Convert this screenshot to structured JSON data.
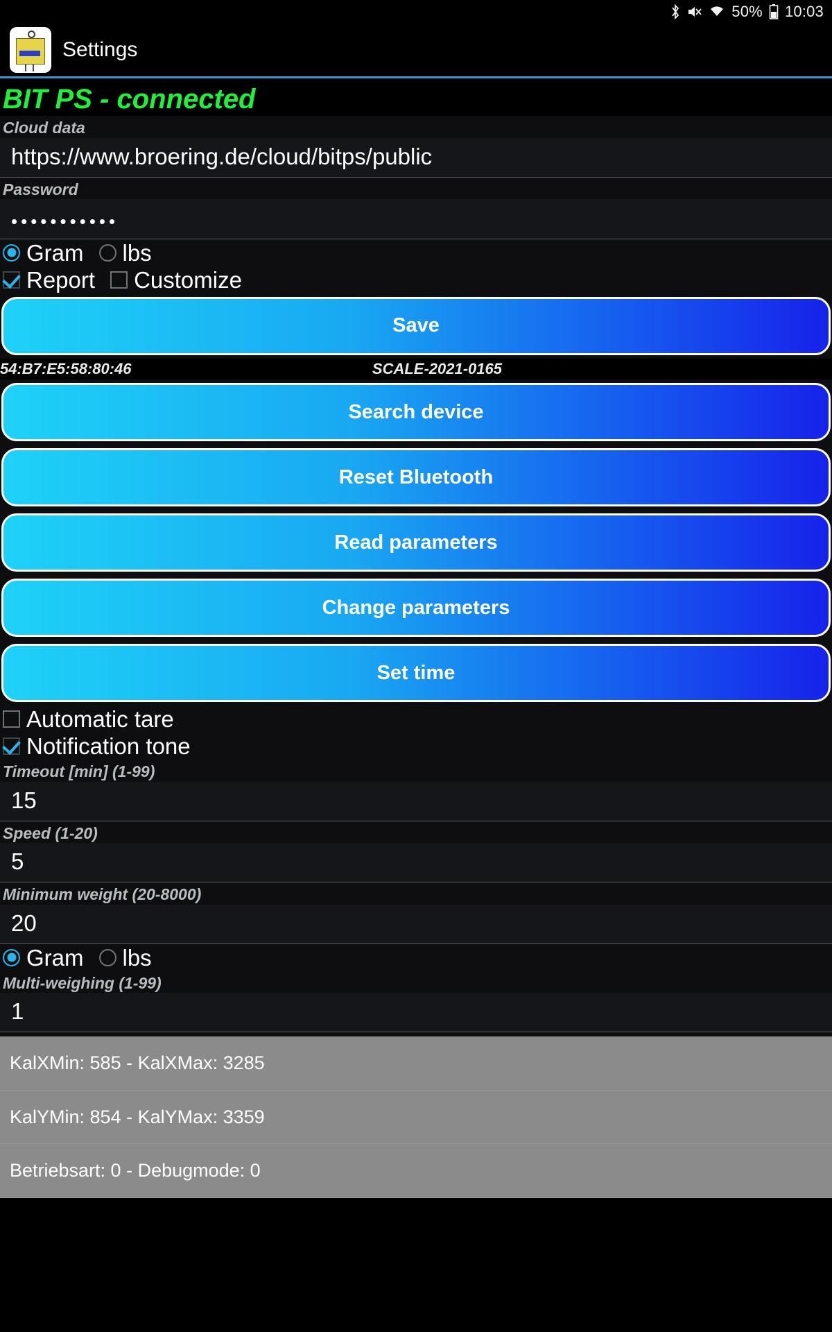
{
  "status_bar": {
    "icons": [
      "bluetooth-icon",
      "volume-mute-icon",
      "wifi-icon"
    ],
    "battery_percent": "50%",
    "time": "10:03"
  },
  "toolbar": {
    "app_icon": "scale-app-icon",
    "title": "Settings"
  },
  "connection": {
    "status_text": "BIT PS - connected",
    "status_color": "#20f03c"
  },
  "cloud": {
    "label": "Cloud data",
    "url_value": "https://www.broering.de/cloud/bitps/public",
    "password_label": "Password",
    "password_value": "•••••••••••"
  },
  "unit_top": {
    "options": [
      {
        "label": "Gram",
        "selected": true
      },
      {
        "label": "lbs",
        "selected": false
      }
    ]
  },
  "flags_top": [
    {
      "label": "Report",
      "checked": true
    },
    {
      "label": "Customize",
      "checked": false
    }
  ],
  "buttons": {
    "save": "Save",
    "search_device": "Search device",
    "reset_bluetooth": "Reset Bluetooth",
    "read_parameters": "Read parameters",
    "change_parameters": "Change parameters",
    "set_time": "Set time"
  },
  "device": {
    "mac_address": "54:B7:E5:58:80:46",
    "serial": "SCALE-2021-0165"
  },
  "flags_bottom": [
    {
      "label": "Automatic tare",
      "checked": false
    },
    {
      "label": "Notification tone",
      "checked": true
    }
  ],
  "parameters": [
    {
      "label": "Timeout [min] (1-99)",
      "value": "15"
    },
    {
      "label": "Speed (1-20)",
      "value": "5"
    },
    {
      "label": "Minimum weight (20-8000)",
      "value": "20"
    }
  ],
  "unit_bottom": {
    "options": [
      {
        "label": "Gram",
        "selected": true
      },
      {
        "label": "lbs",
        "selected": false
      }
    ]
  },
  "multi_weighing": {
    "label": "Multi-weighing (1-99)",
    "value": "1"
  },
  "log_rows": [
    "KalXMin: 585 - KalXMax: 3285",
    "KalYMin: 854 - KalYMax: 3359",
    "Betriebsart: 0 - Debugmode: 0"
  ],
  "theme": {
    "accent_cyan": "#1ed2f7",
    "accent_blue": "#1722ea",
    "connected_green": "#20f03c",
    "log_background": "#8b8b8b"
  }
}
